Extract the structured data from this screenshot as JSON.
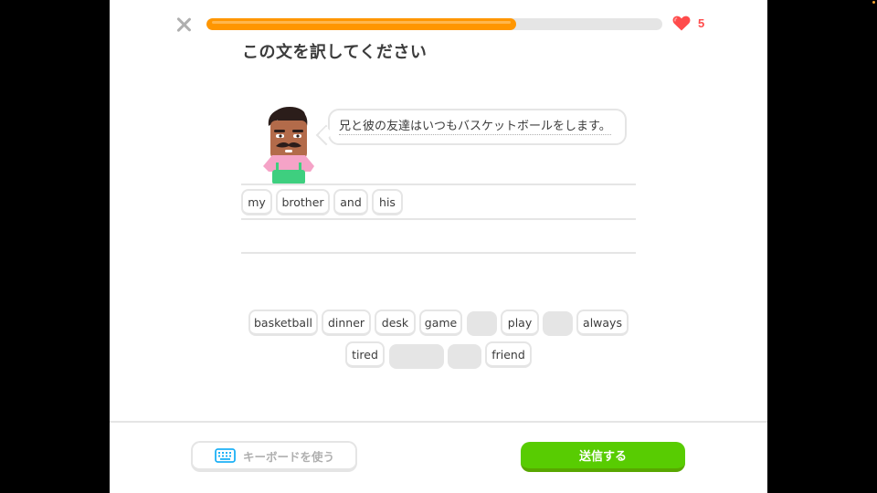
{
  "header": {
    "close_icon": "close-icon",
    "progress": 0.68,
    "progress_color": "#ff9600",
    "hearts_icon": "heart-icon",
    "hearts_count": "5"
  },
  "title": "この文を訳してください",
  "prompt": {
    "sentence": "兄と彼の友達はいつもバスケットボールをします。"
  },
  "answer_chips": [
    "my",
    "brother",
    "and",
    "his"
  ],
  "word_bank": {
    "row1": [
      "basketball",
      "dinner",
      "desk",
      "game",
      "",
      "play",
      "",
      "always"
    ],
    "row2": [
      "tired",
      "",
      "",
      "friend"
    ]
  },
  "footer": {
    "keyboard_icon": "keyboard-icon",
    "keyboard_label": "キーボードを使う",
    "submit_label": "送信する",
    "submit_color": "#58cc02"
  }
}
